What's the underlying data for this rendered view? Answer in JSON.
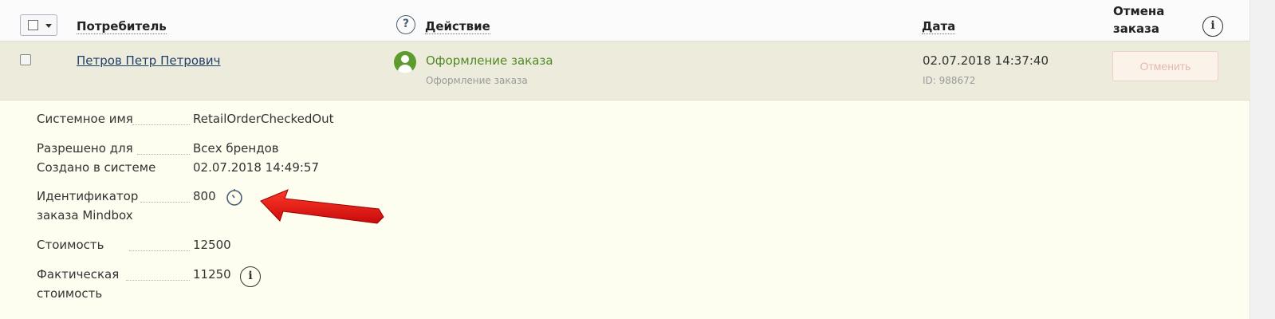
{
  "header": {
    "consumer_label": "Потребитель",
    "help_glyph": "?",
    "action_label": "Действие",
    "date_label": "Дата",
    "cancel_label_line1": "Отмена",
    "cancel_label_line2": "заказа",
    "info_glyph": "i"
  },
  "row": {
    "consumer_name": "Петров Петр Петрович",
    "action_title": "Оформление заказа",
    "action_subtitle": "Оформление заказа",
    "date": "02.07.2018 14:37:40",
    "id": "ID: 988672",
    "cancel_button": "Отменить",
    "accent_color": "#4f8a23"
  },
  "details": {
    "system_name_label": "Системное имя",
    "system_name_value": "RetailOrderCheckedOut",
    "allowed_for_label": "Разрешено для",
    "allowed_for_value": "Всех брендов",
    "created_label": "Создано в системе",
    "created_value": "02.07.2018 14:49:57",
    "order_id_label_line1": "Идентификатор",
    "order_id_label_line2": "заказа Mindbox",
    "order_id_value": "800",
    "cost_label": "Стоимость",
    "cost_value": "12500",
    "actual_cost_label_line1": "Фактическая",
    "actual_cost_label_line2": "стоимость",
    "actual_cost_value": "11250",
    "info_glyph": "i"
  }
}
